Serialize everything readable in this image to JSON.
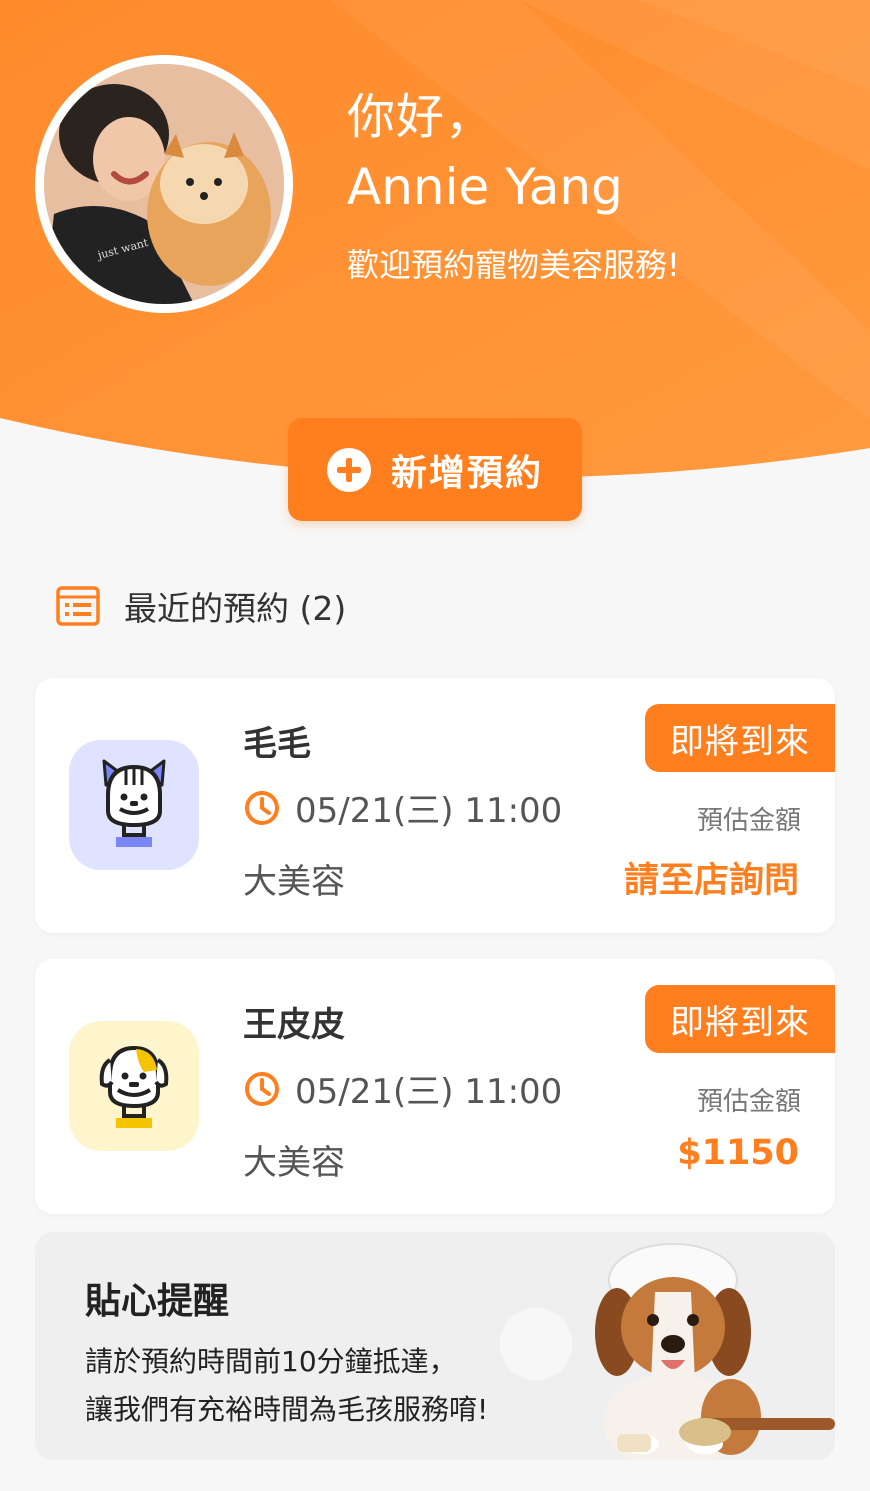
{
  "header": {
    "greeting": "你好，",
    "user_name": "Annie Yang",
    "welcome": "歡迎預約寵物美容服務!",
    "avatar_alt": "user-with-dog-photo"
  },
  "actions": {
    "add_booking_label": "新增預約"
  },
  "recent": {
    "title": "最近的預約 (2)",
    "bookings": [
      {
        "pet_name": "毛毛",
        "datetime": "05/21(三) 11:00",
        "service": "大美容",
        "status": "即將到來",
        "price_label": "預估金額",
        "price": "請至店詢問",
        "icon": "cat-icon",
        "icon_bg": "#dfe3ff",
        "accent": "#7b86f5"
      },
      {
        "pet_name": "王皮皮",
        "datetime": "05/21(三) 11:00",
        "service": "大美容",
        "status": "即將到來",
        "price_label": "預估金額",
        "price": "$1150",
        "icon": "dog-icon",
        "icon_bg": "#fff5cc",
        "accent": "#f5c400"
      }
    ]
  },
  "tip": {
    "title": "貼心提醒",
    "line1": "請於預約時間前10分鐘抵達，",
    "line2": "讓我們有充裕時間為毛孩服務唷!"
  },
  "colors": {
    "brand": "#ff7f1e",
    "background": "#f7f7f7"
  }
}
